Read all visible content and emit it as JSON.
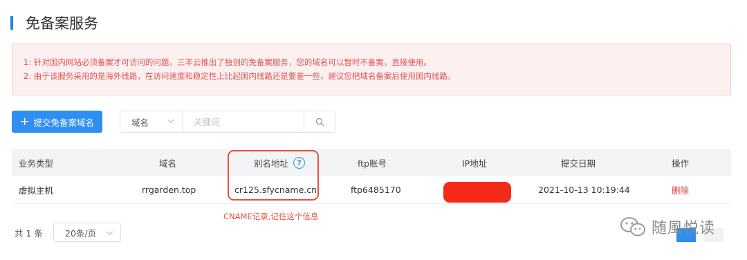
{
  "header": {
    "title": "免备案服务"
  },
  "notice": {
    "lines": [
      "1: 针对国内网站必须备案才可访问的问题，三丰云推出了独创的免备案服务，您的域名可以暂时不备案，直接使用。",
      "2: 由于该服务采用的是海外线路，在访问速度和稳定性上比起国内线路还是要差一些，建议您把域名备案后使用国内线路。"
    ]
  },
  "toolbar": {
    "submit_label": "提交免备案域名",
    "search_field_selected": "域名",
    "search_placeholder": "关键词"
  },
  "table": {
    "headers": [
      "业务类型",
      "域名",
      "别名地址",
      "ftp账号",
      "IP地址",
      "提交日期",
      "操作"
    ],
    "rows": [
      {
        "type": "虚拟主机",
        "domain": "rrgarden.top",
        "cname": "cr125.sfycname.cn",
        "ftp": "ftp6485170",
        "ip": "",
        "date": "2021-10-13 10:19:44",
        "action": "删除"
      }
    ]
  },
  "annotation": {
    "text": "CNAME记录,记住这个信息"
  },
  "pagination": {
    "total_text": "共 1 条",
    "page_size": "20条/页"
  },
  "watermark": {
    "text": "随風悦读"
  },
  "colors": {
    "accent": "#2f8ff0",
    "danger": "#e03a3a",
    "annotation": "#e5533c",
    "redaction": "#f52a1a"
  },
  "icons": {
    "search": "search-icon",
    "dropdown": "chevron-down-icon",
    "help": "question-circle-icon",
    "plus": "plus-icon",
    "wechat": "wechat-icon"
  }
}
